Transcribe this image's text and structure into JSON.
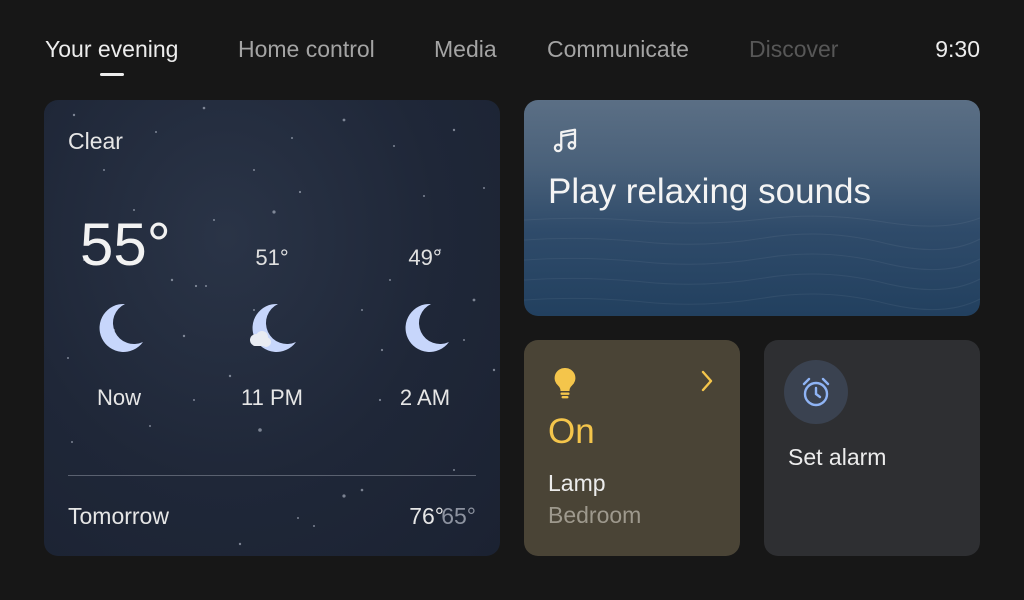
{
  "nav": {
    "tabs": [
      {
        "label": "Your evening",
        "state": "active"
      },
      {
        "label": "Home control",
        "state": "normal"
      },
      {
        "label": "Media",
        "state": "normal"
      },
      {
        "label": "Communicate",
        "state": "normal"
      },
      {
        "label": "Discover",
        "state": "faded"
      }
    ],
    "time": "9:30"
  },
  "weather": {
    "condition": "Clear",
    "current_temp": "55°",
    "hourly": [
      {
        "label": "Now",
        "icon": "moon-icon",
        "temp": ""
      },
      {
        "label": "11 PM",
        "icon": "moon-cloud-icon",
        "temp": "51°"
      },
      {
        "label": "2 AM",
        "icon": "moon-icon",
        "temp": "49°"
      }
    ],
    "tomorrow": {
      "label": "Tomorrow",
      "high": "76°",
      "low": "65°"
    }
  },
  "sounds": {
    "icon": "music-note-icon",
    "label": "Play relaxing sounds"
  },
  "lamp": {
    "icon": "lightbulb-icon",
    "state": "On",
    "name": "Lamp",
    "room": "Bedroom",
    "accent": "#f4c54b"
  },
  "alarm": {
    "icon": "alarm-clock-icon",
    "label": "Set alarm",
    "accent": "#8fb4f5"
  }
}
